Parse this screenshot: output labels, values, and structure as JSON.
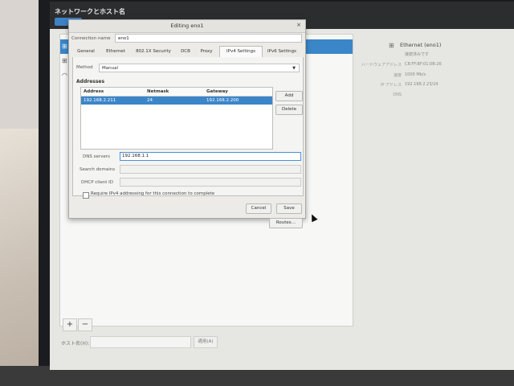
{
  "background_window": {
    "title": "ネットワークとホスト名",
    "hostname_label": "ホスト名(H):",
    "apply_label": "適用(A)",
    "add_symbol": "+",
    "remove_symbol": "−",
    "detail": {
      "heading": "Ethernet (eno1)",
      "status": "接続済みです",
      "rows": [
        {
          "key": "ハードウェアアドレス",
          "value": "C8:FF:BF:01:0B:26"
        },
        {
          "key": "速度",
          "value": "1000 Mb/s"
        },
        {
          "key": "IP アドレス",
          "value": "192.168.2.23/24"
        },
        {
          "key": "DNS",
          "value": ""
        }
      ]
    }
  },
  "dialog": {
    "title": "Editing eno1",
    "close_symbol": "×",
    "connection_name_label": "Connection name",
    "connection_name_value": "eno1",
    "tabs": [
      "General",
      "Ethernet",
      "802.1X Security",
      "DCB",
      "Proxy",
      "IPv4 Settings",
      "IPv6 Settings"
    ],
    "active_tab": "IPv4 Settings",
    "method_label": "Method",
    "method_value": "Manual",
    "addresses_heading": "Addresses",
    "address_columns": [
      "Address",
      "Netmask",
      "Gateway"
    ],
    "address_rows": [
      {
        "address": "192.168.2.211",
        "netmask": "24",
        "gateway": "192.168.2.200"
      }
    ],
    "add_label": "Add",
    "delete_label": "Delete",
    "dns_label": "DNS servers",
    "dns_value": "192.168.1.1",
    "search_domains_label": "Search domains",
    "dhcp_client_id_label": "DHCP client ID",
    "require_ipv4_label": "Require IPv4 addressing for this connection to complete",
    "routes_label": "Routes…",
    "cancel_label": "Cancel",
    "save_label": "Save"
  }
}
